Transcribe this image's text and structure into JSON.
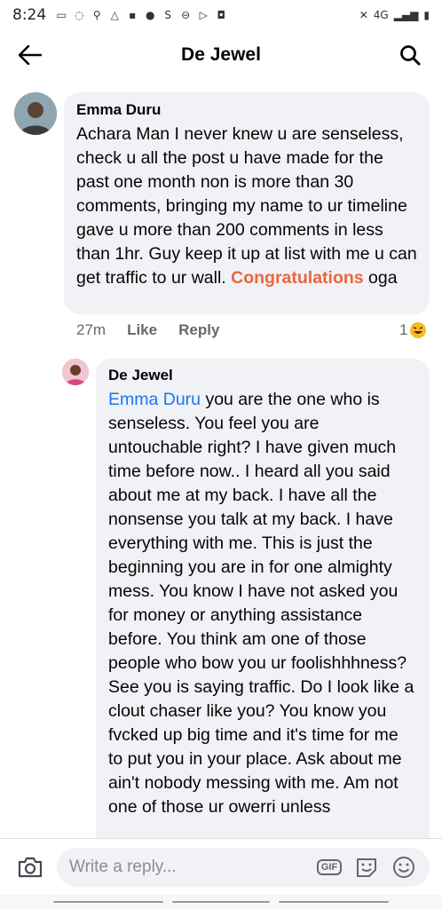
{
  "status_bar": {
    "time": "8:24",
    "network": "4G"
  },
  "header": {
    "title": "De Jewel"
  },
  "comments": [
    {
      "author": "Emma Duru",
      "text_before": "Achara Man I never knew u are senseless, check u all the post u have made for the past one month non is more than 30 comments, bringing my name to ur timeline gave u more than 200 comments in less than 1hr. Guy keep it up at list with me u can get traffic to ur wall. ",
      "highlight": "Congratulations",
      "text_after": " oga",
      "time": "27m",
      "like_label": "Like",
      "reply_label": "Reply",
      "reaction_count": "1"
    },
    {
      "author": "De Jewel",
      "mention": "Emma Duru",
      "text": " you are the one who is senseless. You feel you are untouchable right? I have given much time before now.. I heard all you said about me at my back. I have all the nonsense you talk at my back. I have everything with me. This is just the beginning you are in for one almighty mess. You know I have not asked you for money or anything assistance before. You think am one of those people who bow you ur foolishhhness? See you is saying traffic. Do I look like a clout chaser like you? You know you fvcked up big time and it's time for me to put you in your place. Ask about me ain't nobody messing with me. Am not one of those ur owerri unless"
    }
  ],
  "reply_bar": {
    "placeholder": "Write a reply...",
    "gif_label": "GIF"
  },
  "colors": {
    "bubble": "#f0f2f5",
    "mention": "#1877f2",
    "tag": "#e9663c",
    "meta": "#65676b"
  }
}
